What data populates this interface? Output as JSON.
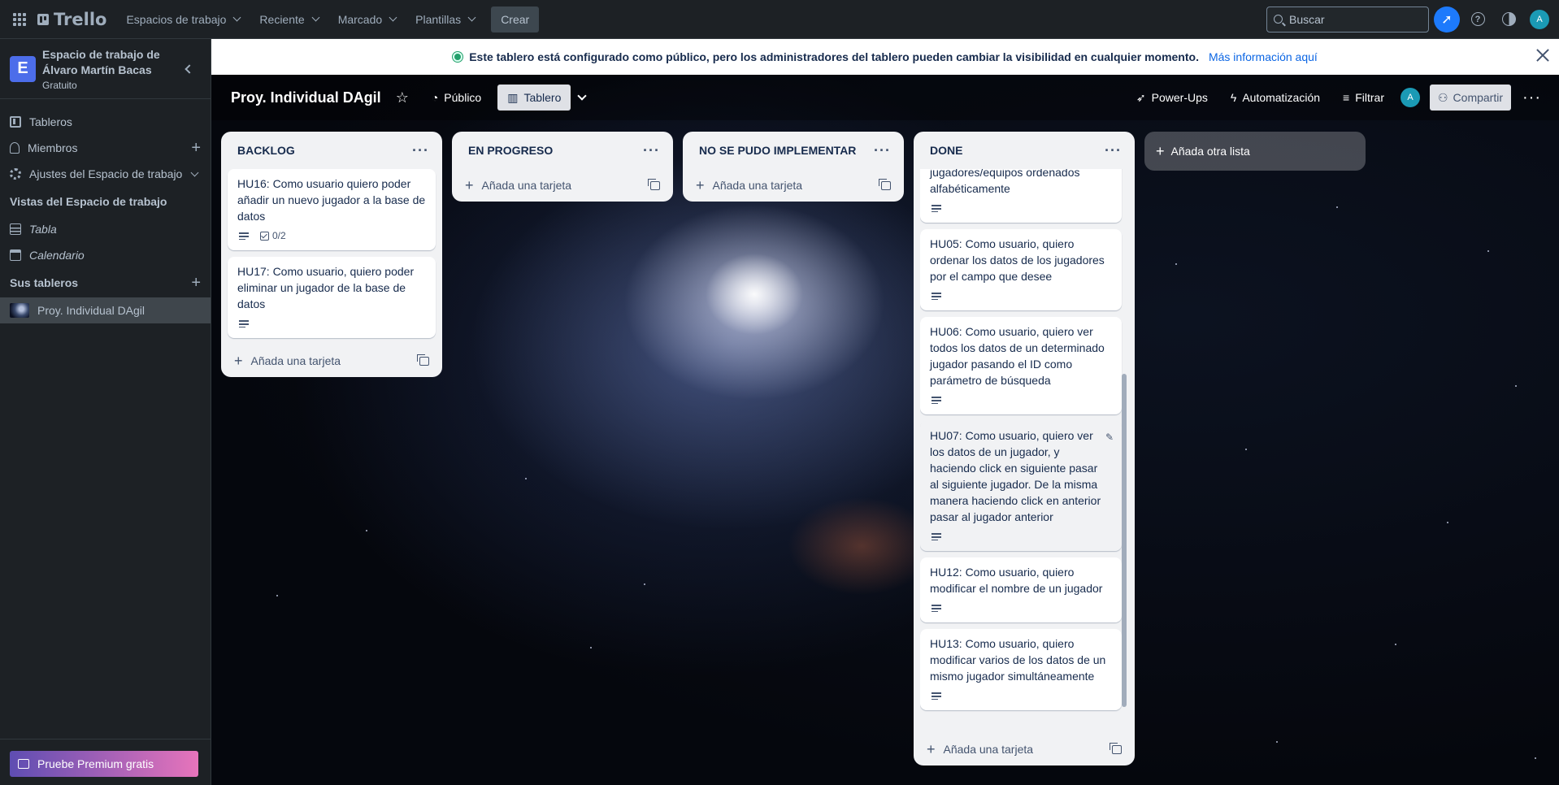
{
  "topbar": {
    "logo": "Trello",
    "nav": [
      {
        "label": "Espacios de trabajo"
      },
      {
        "label": "Reciente"
      },
      {
        "label": "Marcado"
      },
      {
        "label": "Plantillas"
      }
    ],
    "create_label": "Crear",
    "search_placeholder": "Buscar",
    "avatar_initial": "A"
  },
  "sidebar": {
    "workspace_name": "Espacio de trabajo de Álvaro Martín Bacas",
    "workspace_initial": "E",
    "plan": "Gratuito",
    "items": [
      {
        "label": "Tableros"
      },
      {
        "label": "Miembros"
      },
      {
        "label": "Ajustes del Espacio de trabajo"
      }
    ],
    "views_heading": "Vistas del Espacio de trabajo",
    "views": [
      {
        "label": "Tabla"
      },
      {
        "label": "Calendario"
      }
    ],
    "boards_heading": "Sus tableros",
    "boards": [
      {
        "label": "Proy. Individual DAgil"
      }
    ],
    "premium_label": "Pruebe Premium gratis"
  },
  "banner": {
    "text": "Este tablero está configurado como público, pero los administradores del tablero pueden cambiar la visibilidad en cualquier momento.",
    "link": "Más información aquí"
  },
  "board": {
    "title": "Proy. Individual DAgil",
    "visibility_label": "Público",
    "view_label": "Tablero",
    "powerups_label": "Power-Ups",
    "automation_label": "Automatización",
    "filter_label": "Filtrar",
    "share_label": "Compartir",
    "avatar_initial": "A",
    "add_list_label": "Añada otra lista",
    "add_card_label": "Añada una tarjeta",
    "lists": [
      {
        "title": "BACKLOG",
        "cards": [
          {
            "text": "HU16: Como usuario quiero poder añadir un nuevo jugador a la base de datos",
            "description": true,
            "checklist": "0/2"
          },
          {
            "text": "HU17: Como usuario, quiero poder eliminar un jugador de la base de datos",
            "description": true
          }
        ]
      },
      {
        "title": "EN PROGRESO",
        "cards": []
      },
      {
        "title": "NO SE PUDO IMPLEMENTAR",
        "cards": []
      },
      {
        "title": "DONE",
        "cards": [
          {
            "text": "jugadores/equipos ordenados alfabéticamente",
            "description": true
          },
          {
            "text": "HU05: Como usuario, quiero ordenar los datos de los jugadores por el campo que desee",
            "description": true
          },
          {
            "text": "HU06: Como usuario, quiero ver todos los datos de un determinado jugador pasando el ID como parámetro de búsqueda",
            "description": true
          },
          {
            "text": "HU07: Como usuario, quiero ver los datos de un jugador, y haciendo click en siguiente pasar al siguiente jugador. De la misma manera haciendo click en anterior pasar al jugador anterior",
            "description": true
          },
          {
            "text": "HU12: Como usuario, quiero modificar el nombre de un jugador",
            "description": true
          },
          {
            "text": "HU13: Como usuario, quiero modificar varios de los datos de un mismo jugador simultáneamente",
            "description": true
          }
        ]
      }
    ]
  },
  "colors": {
    "topbar_bg": "#1d2125",
    "accent_blue": "#1d7afc",
    "list_bg": "#f1f2f4",
    "card_bg": "#ffffff",
    "premium_gradient_start": "#5e4db2",
    "premium_gradient_end": "#e774bb"
  },
  "icons": [
    "apps-grid-icon",
    "trello-logo-icon",
    "search-icon",
    "notification-icon",
    "help-icon",
    "theme-icon",
    "board-icon",
    "members-icon",
    "settings-icon",
    "table-icon",
    "calendar-icon",
    "star-icon",
    "globe-icon",
    "board-view-icon",
    "powerups-icon",
    "automation-icon",
    "filter-icon",
    "share-icon",
    "more-icon",
    "description-icon",
    "checklist-icon",
    "template-icon",
    "plus-icon",
    "close-icon",
    "edit-icon"
  ]
}
